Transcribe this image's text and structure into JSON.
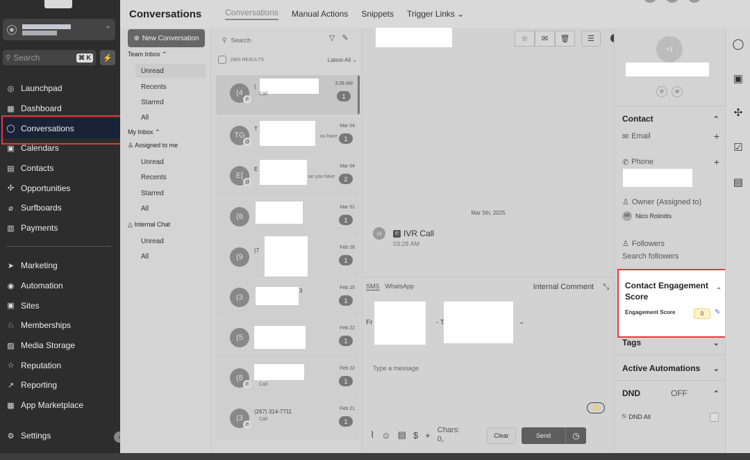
{
  "sidebar": {
    "search_placeholder": "Search",
    "search_shortcut": "⌘ K",
    "nav_top": [
      {
        "label": "Launchpad",
        "icon": "rocket-icon",
        "glyph": "◎"
      },
      {
        "label": "Dashboard",
        "icon": "dashboard-icon",
        "glyph": "▦"
      },
      {
        "label": "Conversations",
        "icon": "chat-icon",
        "glyph": "◯"
      },
      {
        "label": "Calendars",
        "icon": "calendar-icon",
        "glyph": "▣"
      },
      {
        "label": "Contacts",
        "icon": "contacts-icon",
        "glyph": "▤"
      },
      {
        "label": "Opportunities",
        "icon": "opportunities-icon",
        "glyph": "✣"
      },
      {
        "label": "Surfboards",
        "icon": "surfboard-icon",
        "glyph": "⌀"
      },
      {
        "label": "Payments",
        "icon": "payments-icon",
        "glyph": "▥"
      }
    ],
    "nav_bottom": [
      {
        "label": "Marketing",
        "icon": "send-icon",
        "glyph": "➤"
      },
      {
        "label": "Automation",
        "icon": "automation-icon",
        "glyph": "◉"
      },
      {
        "label": "Sites",
        "icon": "sites-icon",
        "glyph": "▣"
      },
      {
        "label": "Memberships",
        "icon": "membership-icon",
        "glyph": "♘"
      },
      {
        "label": "Media Storage",
        "icon": "media-icon",
        "glyph": "▨"
      },
      {
        "label": "Reputation",
        "icon": "star-icon",
        "glyph": "☆"
      },
      {
        "label": "Reporting",
        "icon": "reporting-icon",
        "glyph": "↗"
      },
      {
        "label": "App Marketplace",
        "icon": "marketplace-icon",
        "glyph": "▦"
      }
    ],
    "settings_label": "Settings"
  },
  "topbar": {
    "title": "Conversations",
    "tabs": [
      "Conversations",
      "Manual Actions",
      "Snippets",
      "Trigger Links"
    ]
  },
  "inbox": {
    "new_conversation": "New Conversation",
    "team_inbox": "Team Inbox",
    "team_items": [
      "Unread",
      "Recents",
      "Starred",
      "All"
    ],
    "my_inbox": "My Inbox",
    "assigned": "Assigned to me",
    "my_items": [
      "Unread",
      "Recents",
      "Starred",
      "All"
    ],
    "internal_chat": "Internal Chat",
    "chat_items": [
      "Unread",
      "All"
    ]
  },
  "list": {
    "search_placeholder": "Search",
    "results": "2983 RESULTS",
    "sort": "Latest-All",
    "cards": [
      {
        "avatar": "(4",
        "name": "(",
        "sub": "Call",
        "date": "3:28 AM",
        "count": "1"
      },
      {
        "avatar": "TG",
        "name": "T",
        "sub": "ou have",
        "date": "Mar 04",
        "count": "1"
      },
      {
        "avatar": "E[",
        "name": "E",
        "sub": "ao you have",
        "date": "Mar 04",
        "count": "2"
      },
      {
        "avatar": "(8",
        "name": "",
        "sub": "",
        "date": "Mar 01",
        "count": "1"
      },
      {
        "avatar": "(9",
        "name": "(7",
        "sub": "",
        "date": "Feb 26",
        "count": "1"
      },
      {
        "avatar": "(3",
        "name": "3",
        "sub": "",
        "date": "Feb 25",
        "count": "1"
      },
      {
        "avatar": "(5",
        "name": "",
        "sub": "",
        "date": "Feb 22",
        "count": "1"
      },
      {
        "avatar": "(8",
        "name": "",
        "sub": "Call",
        "date": "Feb 22",
        "count": "1"
      },
      {
        "avatar": "(3",
        "name": "(267) 314-7711",
        "sub": "Call",
        "date": "Feb 21",
        "count": "1"
      }
    ]
  },
  "conversation": {
    "date_separator": "Mar 5th, 2025",
    "ivr_avatar": "(4",
    "ivr_label": "IVR Call",
    "ivr_time": "03:28 AM",
    "channel_tabs": [
      "SMS",
      "WhatsApp"
    ],
    "internal_comment": "Internal Comment",
    "from_label": "Fr",
    "to_label": "- To",
    "message_placeholder": "Type a message",
    "chars_label": "Chars:",
    "chars_value": "0,",
    "clear": "Clear",
    "send": "Send"
  },
  "contact": {
    "avatar": "+1",
    "section_contact": "Contact",
    "email_label": "Email",
    "phone_label": "Phone",
    "owner_label": "Owner (Assigned to)",
    "owner_initials": "NR",
    "owner_name": "Nico Rolinitis",
    "followers_label": "Followers",
    "followers_placeholder": "Search followers",
    "engagement_title": "Contact Engagement Score",
    "engagement_label": "Engagement Score",
    "engagement_value": "0",
    "tags": "Tags",
    "active_automations": "Active Automations",
    "dnd": "DND",
    "dnd_state": "OFF",
    "dnd_all": "DND All"
  },
  "colors": {
    "highlight": "#e23a3a",
    "sidebar_bg": "#2d2d2d",
    "active_nav": "#1a2335",
    "score_bg": "#fef3c7",
    "edit_icon": "#3b82f6"
  }
}
